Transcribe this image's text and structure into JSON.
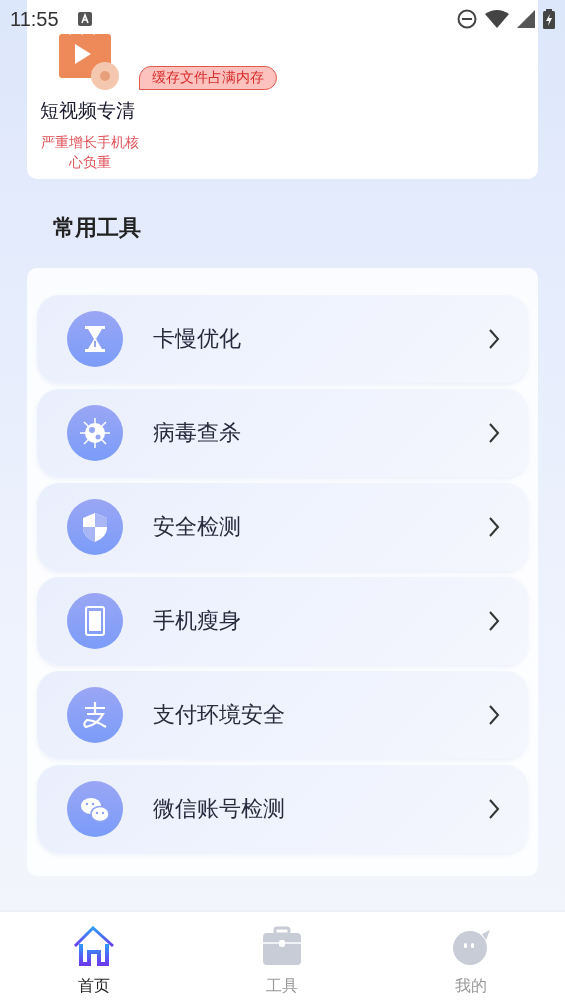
{
  "status_bar": {
    "time": "11:55"
  },
  "clean_card": {
    "badge": "缓存文件占满内存",
    "title": "短视频专清",
    "warning": "严重增长手机核心负重"
  },
  "section_title": "常用工具",
  "tools": [
    {
      "kind": "hourglass",
      "label": "卡慢优化"
    },
    {
      "kind": "virus",
      "label": "病毒查杀"
    },
    {
      "kind": "shield",
      "label": "安全检测"
    },
    {
      "kind": "phone",
      "label": "手机瘦身"
    },
    {
      "kind": "payment",
      "label": "支付环境安全"
    },
    {
      "kind": "chat",
      "label": "微信账号检测"
    }
  ],
  "bottom_nav": [
    {
      "kind": "home",
      "label": "首页",
      "selected": true
    },
    {
      "kind": "toolbox",
      "label": "工具",
      "selected": false
    },
    {
      "kind": "profile",
      "label": "我的",
      "selected": false
    }
  ]
}
